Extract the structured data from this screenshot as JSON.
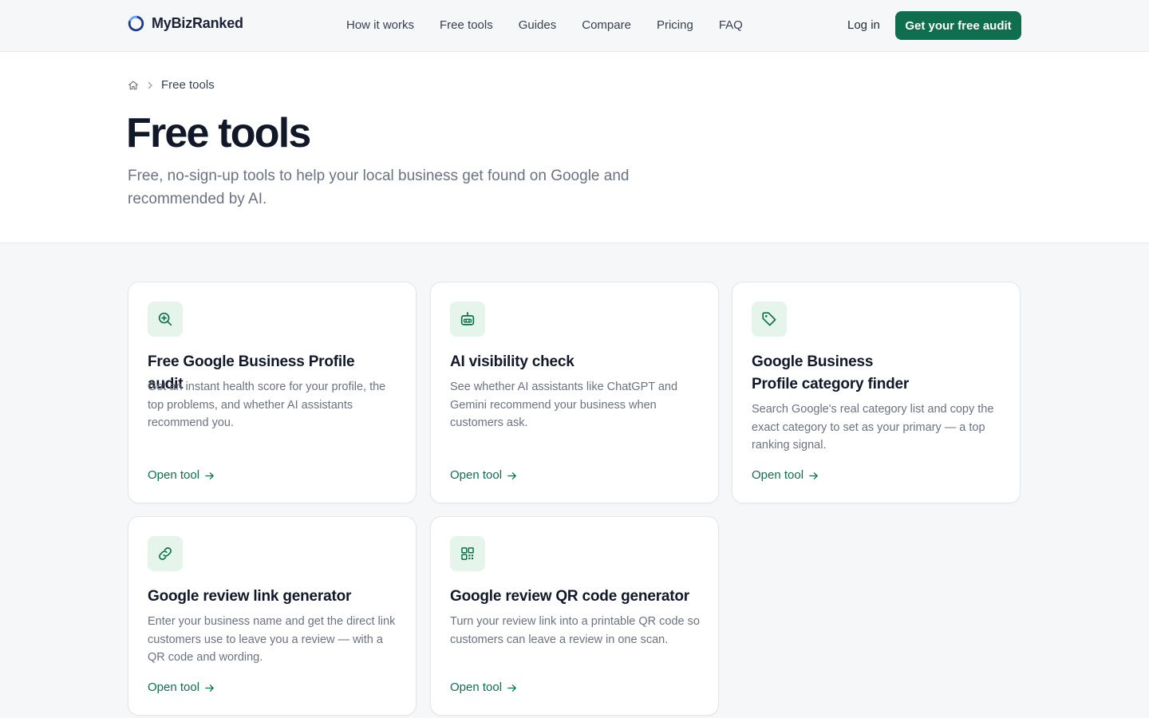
{
  "header": {
    "brand": "MyBizRanked",
    "nav": [
      "How it works",
      "Free tools",
      "Guides",
      "Compare",
      "Pricing",
      "FAQ"
    ],
    "login_label": "Log in",
    "cta_label": "Get your free audit",
    "accent_color": "#0f6e4d"
  },
  "breadcrumb": {
    "home_icon": "home-icon",
    "separator_icon": "chevron-right-icon",
    "current": "Free tools"
  },
  "page": {
    "title": "Free tools",
    "subtitle": "Free, no-sign-up tools to help your local business get found on Google and recommended by AI."
  },
  "tools": [
    {
      "icon": "search-plus-icon",
      "title": "Free Google Business Profile audit",
      "description": "Get an instant health score for your profile, the top problems, and whether AI assistants recommend you.",
      "link_label": "Open tool"
    },
    {
      "icon": "robot-icon",
      "title": "AI visibility check",
      "description": "See whether AI assistants like ChatGPT and Gemini recommend your business when customers ask.",
      "link_label": "Open tool"
    },
    {
      "icon": "tag-icon",
      "title": "Google Business Profile category finder",
      "description": "Search Google's real category list and copy the exact category to set as your primary — a top ranking signal.",
      "link_label": "Open tool"
    },
    {
      "icon": "link-icon",
      "title": "Google review link generator",
      "description": "Enter your business name and get the direct link customers use to leave you a review — with a QR code and wording.",
      "link_label": "Open tool"
    },
    {
      "icon": "qr-code-icon",
      "title": "Google review QR code generator",
      "description": "Turn your review link into a printable QR code so customers can leave a review in one scan.",
      "link_label": "Open tool"
    }
  ]
}
